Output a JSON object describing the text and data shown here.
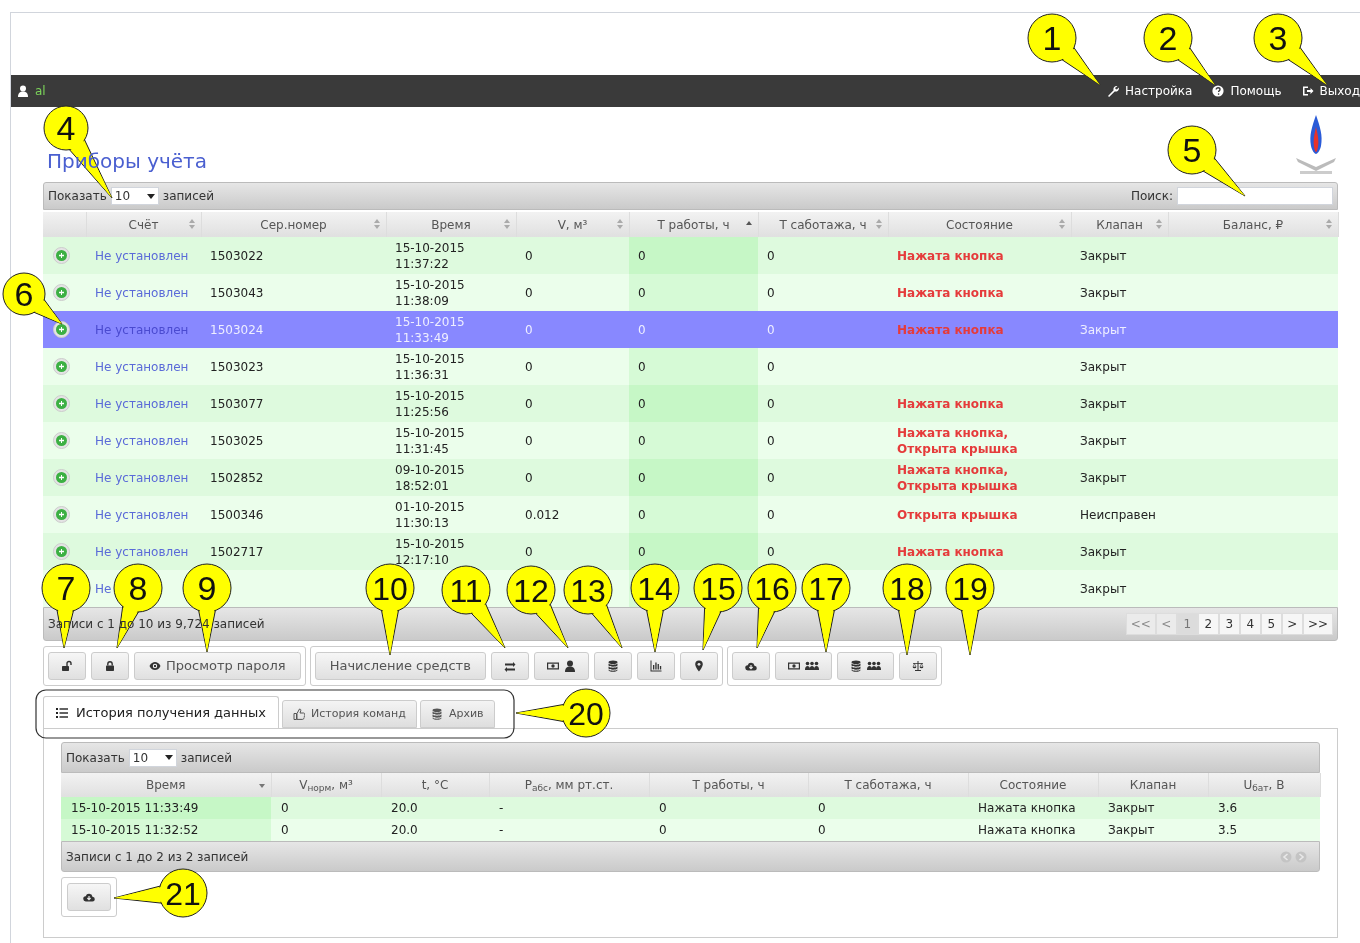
{
  "top_bar": {
    "user": "al",
    "links": [
      {
        "label": "Настройка"
      },
      {
        "label": "Помощь"
      },
      {
        "label": "Выход"
      }
    ]
  },
  "title": "Приборы учёта",
  "devices_table": {
    "length_before": "Показать",
    "length_value": "10",
    "length_after": "записей",
    "search_label": "Поиск:",
    "columns": [
      {
        "kind": "plain"
      },
      {
        "label": "Счёт",
        "kind": "sortable"
      },
      {
        "label": "Сер.номер",
        "kind": "sortable"
      },
      {
        "label": "Время",
        "kind": "sortable"
      },
      {
        "label": "V, м³",
        "kind": "sortable"
      },
      {
        "label": "Т работы, ч",
        "kind": "ascending"
      },
      {
        "label": "Т саботажа, ч",
        "kind": "sortable"
      },
      {
        "label": "Состояние",
        "kind": "sortable"
      },
      {
        "label": "Клапан",
        "kind": "sortable"
      },
      {
        "label": "Баланс, ₽",
        "kind": "sortable"
      }
    ],
    "rows": [
      {
        "account": "Не установлен",
        "serial": "1503022",
        "time": "15-10-2015 11:37:22",
        "volume": "0",
        "work": "0",
        "sabotage": "0",
        "state": "Нажата кнопка",
        "valve": "Закрыт",
        "selected": false
      },
      {
        "account": "Не установлен",
        "serial": "1503043",
        "time": "15-10-2015 11:38:09",
        "volume": "0",
        "work": "0",
        "sabotage": "0",
        "state": "Нажата кнопка",
        "valve": "Закрыт",
        "selected": false
      },
      {
        "account": "Не установлен",
        "serial": "1503024",
        "time": "15-10-2015 11:33:49",
        "volume": "0",
        "work": "0",
        "sabotage": "0",
        "state": "Нажата кнопка",
        "valve": "Закрыт",
        "selected": true
      },
      {
        "account": "Не установлен",
        "serial": "1503023",
        "time": "15-10-2015 11:36:31",
        "volume": "0",
        "work": "0",
        "sabotage": "0",
        "valve": "Закрыт",
        "selected": false
      },
      {
        "account": "Не установлен",
        "serial": "1503077",
        "time": "15-10-2015 11:25:56",
        "volume": "0",
        "work": "0",
        "sabotage": "0",
        "state": "Нажата кнопка",
        "valve": "Закрыт",
        "selected": false
      },
      {
        "account": "Не установлен",
        "serial": "1503025",
        "time": "15-10-2015 11:31:45",
        "volume": "0",
        "work": "0",
        "sabotage": "0",
        "state": "Нажата кнопка,\nОткрыта крышка",
        "valve": "Закрыт",
        "selected": false
      },
      {
        "account": "Не установлен",
        "serial": "1502852",
        "time": "09-10-2015 18:52:01",
        "volume": "0",
        "work": "0",
        "sabotage": "0",
        "state": "Нажата кнопка,\nОткрыта крышка",
        "valve": "Закрыт",
        "selected": false
      },
      {
        "account": "Не установлен",
        "serial": "1500346",
        "time": "01-10-2015 11:30:13",
        "volume": "0.012",
        "work": "0",
        "sabotage": "0",
        "state": "Открыта крышка",
        "valve": "Неисправен",
        "selected": false
      },
      {
        "account": "Не установлен",
        "serial": "1502717",
        "time": "15-10-2015 12:17:10",
        "volume": "0",
        "work": "0",
        "sabotage": "0",
        "state": "Нажата кнопка",
        "valve": "Закрыт",
        "selected": false
      },
      {
        "account": "Не",
        "valve": "Закрыт",
        "selected": false
      }
    ],
    "info": "Записи с 1 до 10 из 9,724 записей",
    "pagination": [
      {
        "label": "<<",
        "selected": false,
        "disabled": true
      },
      {
        "label": "<",
        "selected": false,
        "disabled": true
      },
      {
        "label": "1",
        "selected": true,
        "disabled": false
      },
      {
        "label": "2",
        "selected": false,
        "disabled": false
      },
      {
        "label": "3",
        "selected": false,
        "disabled": false
      },
      {
        "label": "4",
        "selected": false,
        "disabled": false
      },
      {
        "label": "5",
        "selected": false,
        "disabled": false
      },
      {
        "label": ">",
        "selected": false,
        "disabled": false
      },
      {
        "label": ">>",
        "selected": false,
        "disabled": false
      }
    ]
  },
  "toolbar_groups": [
    [
      {
        "kind": "icon"
      },
      {
        "kind": "icon"
      },
      {
        "kind": "text",
        "label": "Просмотр пароля"
      }
    ],
    [
      {
        "kind": "text",
        "label": "Начисление средств"
      },
      {
        "kind": "icon"
      },
      {
        "kind": "icon"
      },
      {
        "kind": "icon"
      },
      {
        "kind": "icon"
      },
      {
        "kind": "icon"
      }
    ],
    [
      {
        "kind": "icon"
      },
      {
        "kind": "icon"
      },
      {
        "kind": "icon"
      },
      {
        "kind": "icon"
      }
    ]
  ],
  "tabs": [
    {
      "label": "История получения данных",
      "selected": true
    },
    {
      "label": "История команд",
      "selected": false
    },
    {
      "label": "Архив",
      "selected": false
    }
  ],
  "history_table": {
    "length_before": "Показать",
    "length_value": "10",
    "length_after": "записей",
    "columns": [
      {
        "label": "Время",
        "kind": "descending"
      },
      {
        "label": "V$_{норм}$, м³",
        "kind": "plain"
      },
      {
        "label": "t, °C",
        "kind": "plain"
      },
      {
        "label": "P$_{абс}$, мм рт.ст.",
        "kind": "plain"
      },
      {
        "label": "Т работы, ч",
        "kind": "plain"
      },
      {
        "label": "Т саботажа, ч",
        "kind": "plain"
      },
      {
        "label": "Состояние",
        "kind": "plain"
      },
      {
        "label": "Клапан",
        "kind": "plain"
      },
      {
        "label": "U$_{бат}$, В",
        "kind": "plain"
      }
    ],
    "rows": [
      {
        "cells": [
          "15-10-2015 11:33:49",
          "0",
          "20.0",
          "-",
          "0",
          "0",
          "Нажата кнопка",
          "Закрыт",
          "3.6"
        ]
      },
      {
        "cells": [
          "15-10-2015 11:32:52",
          "0",
          "20.0",
          "-",
          "0",
          "0",
          "Нажата кнопка",
          "Закрыт",
          "3.5"
        ]
      }
    ],
    "info": "Записи с 1 до 2 из 2 записей"
  },
  "callouts": [
    "1",
    "2",
    "3",
    "4",
    "5",
    "6",
    "7",
    "8",
    "9",
    "10",
    "11",
    "12",
    "13",
    "14",
    "15",
    "16",
    "17",
    "18",
    "19",
    "20",
    "21"
  ]
}
